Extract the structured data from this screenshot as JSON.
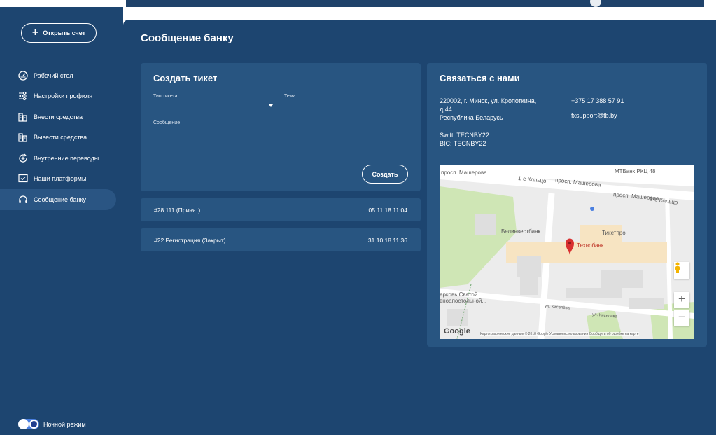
{
  "sidebar": {
    "open_account": {
      "plus": "+",
      "label": "Открыть счет"
    },
    "items": [
      {
        "label": "Рабочий стол",
        "icon": "dashboard-icon"
      },
      {
        "label": "Настройки профиля",
        "icon": "settings-sliders-icon"
      },
      {
        "label": "Внести средства",
        "icon": "deposit-icon"
      },
      {
        "label": "Вывести средства",
        "icon": "withdraw-icon"
      },
      {
        "label": "Внутренние переводы",
        "icon": "transfer-icon"
      },
      {
        "label": "Наши платформы",
        "icon": "platform-icon"
      },
      {
        "label": "Сообщение банку",
        "icon": "headset-icon",
        "active": true
      }
    ],
    "night_mode": {
      "label": "Ночной режим",
      "enabled": true
    }
  },
  "main": {
    "title": "Сообщение банку",
    "ticket_form": {
      "title": "Создать тикет",
      "type_label": "Тип тикета",
      "type_value": "",
      "topic_label": "Тема",
      "topic_value": "",
      "message_label": "Сообщение",
      "message_value": "",
      "submit_label": "Создать"
    },
    "tickets": [
      {
        "name": "#28 111 (Принят)",
        "date": "05.11.18 11:04"
      },
      {
        "name": "#22 Регистрация (Закрыт)",
        "date": "31.10.18 11:36"
      }
    ],
    "contact": {
      "title": "Связаться с нами",
      "address_line1": "220002, г. Минск, ул. Кропоткина,",
      "address_line2": "д.44",
      "address_line3": "Республика Беларусь",
      "phone": "+375 17 388 57 91",
      "email": "fxsupport@tb.by",
      "swift": "Swift: TECNBY22",
      "bic": "BIC: TECNBY22",
      "map": {
        "labels": {
          "street1": "просп. Машерова",
          "street2": "1-е Кольцо",
          "street3": "просп. Машерова",
          "street4": "просп. Машерова",
          "street5": "1-е Кольцо",
          "bank1": "МТБанк РКЦ 48",
          "bank2": "Белинвестбанк",
          "ticket": "Тикетпро",
          "technobank": "Технобанк",
          "church": "ерковь Святой",
          "church2": "вноапостольной...",
          "street6": "ул. Киселёва",
          "street7": "ул. Киселева"
        },
        "google": "Google",
        "attribution": "Картографические данные © 2018 Google   Условия использования   Сообщить об ошибке на карте",
        "zoom_in": "+",
        "zoom_out": "−"
      }
    }
  },
  "colors": {
    "sidebar_bg": "#1d4570",
    "card_bg": "#285581",
    "accent_toggle": "#4a7fe0",
    "map_marker": "#d93030"
  }
}
